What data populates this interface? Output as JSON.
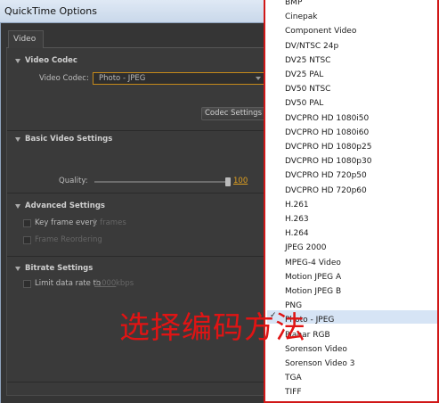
{
  "window": {
    "title": "QuickTime Options"
  },
  "tabs": [
    {
      "label": "Video"
    }
  ],
  "video_codec": {
    "section_title": "Video Codec",
    "codec_label": "Video Codec:",
    "codec_value": "Photo - JPEG",
    "settings_button": "Codec Settings"
  },
  "basic_video": {
    "section_title": "Basic Video Settings",
    "quality_label": "Quality:",
    "quality_value": "100",
    "quality_fraction": 1.0
  },
  "advanced": {
    "section_title": "Advanced Settings",
    "keyframe_label": "Key frame every",
    "keyframe_value": "1 frames",
    "reordering_label": "Frame Reordering"
  },
  "bitrate": {
    "section_title": "Bitrate Settings",
    "limit_label": "Limit data rate to",
    "limit_value": "1,000",
    "limit_unit": "kbps"
  },
  "dropdown": {
    "items": [
      "BMP",
      "Cinepak",
      "Component Video",
      "DV/NTSC 24p",
      "DV25 NTSC",
      "DV25 PAL",
      "DV50 NTSC",
      "DV50 PAL",
      "DVCPRO HD 1080i50",
      "DVCPRO HD 1080i60",
      "DVCPRO HD 1080p25",
      "DVCPRO HD 1080p30",
      "DVCPRO HD 720p50",
      "DVCPRO HD 720p60",
      "H.261",
      "H.263",
      "H.264",
      "JPEG 2000",
      "MPEG-4 Video",
      "Motion JPEG A",
      "Motion JPEG B",
      "PNG",
      "Photo - JPEG",
      "Planar RGB",
      "Sorenson Video",
      "Sorenson Video 3",
      "TGA",
      "TIFF"
    ],
    "selected": "Photo - JPEG"
  },
  "annotation": {
    "text": "选择编码方法",
    "color": "#e01414"
  },
  "colors": {
    "accent": "#e0a020",
    "highlight_border": "#d01818",
    "selected_row": "#d6e4f5"
  }
}
